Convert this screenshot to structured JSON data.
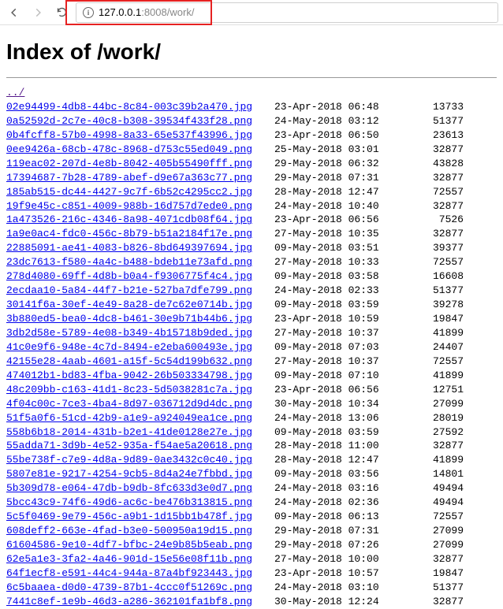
{
  "address": {
    "host": "127.0.0.1",
    "port": ":8008",
    "path": "/work/"
  },
  "heading": "Index of /work/",
  "parent": "../",
  "files": [
    {
      "name": "02e94499-4db8-44bc-8c84-003c39b2a470.jpg",
      "mtime": "23-Apr-2018 06:48",
      "size": "13733"
    },
    {
      "name": "0a52592d-2c7e-40c8-b308-39534f433f28.png",
      "mtime": "24-May-2018 03:12",
      "size": "51377"
    },
    {
      "name": "0b4fcff8-57b0-4998-8a33-65e537f43996.jpg",
      "mtime": "23-Apr-2018 06:50",
      "size": "23613"
    },
    {
      "name": "0ee9426a-68cb-478c-8968-d753c55ed049.png",
      "mtime": "25-May-2018 03:01",
      "size": "32877"
    },
    {
      "name": "119eac02-207d-4e8b-8042-405b55490fff.png",
      "mtime": "29-May-2018 06:32",
      "size": "43828"
    },
    {
      "name": "17394687-7b28-4789-abef-d9e67a363c77.png",
      "mtime": "29-May-2018 07:31",
      "size": "32877"
    },
    {
      "name": "185ab515-dc44-4427-9c7f-6b52c4295cc2.jpg",
      "mtime": "28-May-2018 12:47",
      "size": "72557"
    },
    {
      "name": "19f9e45c-c851-4009-988b-16d757d7ede0.png",
      "mtime": "24-May-2018 10:40",
      "size": "32877"
    },
    {
      "name": "1a473526-216c-4346-8a98-4071cdb08f64.jpg",
      "mtime": "23-Apr-2018 06:56",
      "size": "7526"
    },
    {
      "name": "1a9e0ac4-fdc0-456c-8b79-b51a2184f17e.png",
      "mtime": "27-May-2018 10:35",
      "size": "32877"
    },
    {
      "name": "22885091-ae41-4083-b826-8bd649397694.jpg",
      "mtime": "09-May-2018 03:51",
      "size": "39377"
    },
    {
      "name": "23dc7613-f580-4a4c-b488-bdeb11e73afd.png",
      "mtime": "27-May-2018 10:33",
      "size": "72557"
    },
    {
      "name": "278d4080-69ff-4d8b-b0a4-f9306775f4c4.jpg",
      "mtime": "09-May-2018 03:58",
      "size": "16608"
    },
    {
      "name": "2ecdaa10-5a84-44f7-b21e-527ba7dfe799.png",
      "mtime": "24-May-2018 02:33",
      "size": "51377"
    },
    {
      "name": "30141f6a-30ef-4e49-8a28-de7c62e0714b.jpg",
      "mtime": "09-May-2018 03:59",
      "size": "39278"
    },
    {
      "name": "3b880ed5-bea0-4dc8-b461-30e9b71b44b6.jpg",
      "mtime": "23-Apr-2018 10:59",
      "size": "19847"
    },
    {
      "name": "3db2d58e-5789-4e08-b349-4b15718b9ded.jpg",
      "mtime": "27-May-2018 10:37",
      "size": "41899"
    },
    {
      "name": "41c0e9f6-948e-4c7d-8494-e2eba600493e.jpg",
      "mtime": "09-May-2018 07:03",
      "size": "24407"
    },
    {
      "name": "42155e28-4aab-4601-a15f-5c54d199b632.png",
      "mtime": "27-May-2018 10:37",
      "size": "72557"
    },
    {
      "name": "474012b1-bd83-4fba-9042-26b503334798.jpg",
      "mtime": "09-May-2018 07:10",
      "size": "41899"
    },
    {
      "name": "48c209bb-c163-41d1-8c23-5d5038281c7a.jpg",
      "mtime": "23-Apr-2018 06:56",
      "size": "12751"
    },
    {
      "name": "4f04c00c-7ce3-4ba4-8d97-036712d9d4dc.png",
      "mtime": "30-May-2018 10:34",
      "size": "27099"
    },
    {
      "name": "51f5a0f6-51cd-42b9-a1e9-a924049ea1ce.png",
      "mtime": "24-May-2018 13:06",
      "size": "28019"
    },
    {
      "name": "558b6b18-2014-431b-b2e1-41de0128e27e.jpg",
      "mtime": "09-May-2018 03:59",
      "size": "27592"
    },
    {
      "name": "55adda71-3d9b-4e52-935a-f54ae5a20618.png",
      "mtime": "28-May-2018 11:00",
      "size": "32877"
    },
    {
      "name": "55be738f-c7e9-4d8a-9d89-0ae3432c0c40.jpg",
      "mtime": "28-May-2018 12:47",
      "size": "41899"
    },
    {
      "name": "5807e81e-9217-4254-9cb5-8d4a24e7fbbd.jpg",
      "mtime": "09-May-2018 03:56",
      "size": "14801"
    },
    {
      "name": "5b309d78-e064-47db-b9db-8fc633d3e0d7.png",
      "mtime": "24-May-2018 03:16",
      "size": "49494"
    },
    {
      "name": "5bcc43c9-74f6-49d6-ac6c-be476b313815.png",
      "mtime": "24-May-2018 02:36",
      "size": "49494"
    },
    {
      "name": "5c5f0469-9e79-456c-a9b1-1d15bb1b478f.jpg",
      "mtime": "09-May-2018 06:13",
      "size": "72557"
    },
    {
      "name": "608deff2-663e-4fad-b3e0-500950a19d15.png",
      "mtime": "29-May-2018 07:31",
      "size": "27099"
    },
    {
      "name": "61604586-9e10-4df7-bfbc-24e9b85b5eab.png",
      "mtime": "29-May-2018 07:26",
      "size": "27099"
    },
    {
      "name": "62e5a1e3-3fa2-4a46-901d-15e56e08f11b.png",
      "mtime": "27-May-2018 10:00",
      "size": "32877"
    },
    {
      "name": "64f1ecf8-e591-44c4-944a-87a4bf923443.jpg",
      "mtime": "23-Apr-2018 10:57",
      "size": "19847"
    },
    {
      "name": "6c5baaea-d0d0-4739-87b1-4ccc0f51269c.png",
      "mtime": "24-May-2018 03:10",
      "size": "51377"
    },
    {
      "name": "7441c8ef-1e9b-46d3-a286-362101fa1bf8.png",
      "mtime": "30-May-2018 12:24",
      "size": "32877"
    }
  ]
}
